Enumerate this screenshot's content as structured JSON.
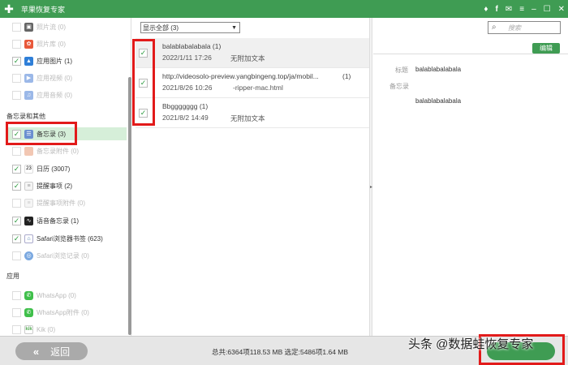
{
  "app": {
    "title": "苹果恢复专家",
    "logo_icon": "plus-logo-icon"
  },
  "sidebar": {
    "items_top": [
      {
        "label": "照片流 (0)",
        "checked": false,
        "dim": true,
        "icon": "photo-stream-icon",
        "color": "#666"
      },
      {
        "label": "照片库 (0)",
        "checked": false,
        "dim": true,
        "icon": "photo-library-icon",
        "color": "#e8583a"
      },
      {
        "label": "应用图片 (1)",
        "checked": true,
        "dim": false,
        "icon": "app-photos-icon",
        "color": "#2f7fd8"
      },
      {
        "label": "应用视频 (0)",
        "checked": false,
        "dim": true,
        "icon": "app-video-icon",
        "color": "#9bb8e8"
      },
      {
        "label": "应用音频 (0)",
        "checked": false,
        "dim": true,
        "icon": "app-audio-icon",
        "color": "#9bb8e8"
      }
    ],
    "section_memo": "备忘录和其他",
    "items_memo": [
      {
        "label": "备忘录 (3)",
        "checked": true,
        "dim": false,
        "icon": "notes-icon",
        "color": "#6a8fd0",
        "selected": true
      },
      {
        "label": "备忘录附件 (0)",
        "checked": false,
        "dim": true,
        "icon": "notes-attachment-icon",
        "color": "#ddd"
      },
      {
        "label": "日历 (3007)",
        "checked": true,
        "dim": false,
        "icon": "calendar-icon",
        "color": "#fff"
      },
      {
        "label": "提醒事项 (2)",
        "checked": true,
        "dim": false,
        "icon": "reminders-icon",
        "color": "#ddd"
      },
      {
        "label": "提醒事项附件 (0)",
        "checked": false,
        "dim": true,
        "icon": "reminders-attachment-icon",
        "color": "#ddd"
      },
      {
        "label": "语音备忘录 (1)",
        "checked": true,
        "dim": false,
        "icon": "voice-memo-icon",
        "color": "#222"
      },
      {
        "label": "Safari浏览器书签 (623)",
        "checked": true,
        "dim": false,
        "icon": "safari-bookmark-icon",
        "color": "#fff"
      },
      {
        "label": "Safari浏览记录 (0)",
        "checked": false,
        "dim": true,
        "icon": "safari-history-icon",
        "color": "#7aa8e0"
      }
    ],
    "section_apps": "应用",
    "items_apps": [
      {
        "label": "WhatsApp (0)",
        "checked": false,
        "dim": true,
        "icon": "whatsapp-icon",
        "color": "#3fbf4a"
      },
      {
        "label": "WhatsApp附件 (0)",
        "checked": false,
        "dim": true,
        "icon": "whatsapp-attachment-icon",
        "color": "#3fbf4a"
      },
      {
        "label": "Kik (0)",
        "checked": false,
        "dim": true,
        "icon": "kik-icon",
        "color": "#fff"
      }
    ]
  },
  "list": {
    "filter": "显示全部 (3)",
    "rows": [
      {
        "title": "balablabalabala (1)",
        "date": "2022/1/11 17:26",
        "sub": "无附加文本",
        "checked": true
      },
      {
        "title": "http://videosolo-preview.yangbingeng.top/ja/mobil...",
        "count": "(1)",
        "date": "2021/8/26 10:26",
        "sub": "-ripper-mac.html",
        "checked": true
      },
      {
        "title": "Bbggggggg (1)",
        "date": "2021/8/2 14:49",
        "sub": "无附加文本",
        "checked": true
      }
    ]
  },
  "search": {
    "placeholder": "搜索"
  },
  "detail": {
    "edit_label": "编辑",
    "title_label": "标题",
    "title_value": "balablabalabala",
    "memo_label": "备忘录",
    "memo_value": "balablabalabala"
  },
  "bottom": {
    "back_label": "返回",
    "totals": "总共:6364项118.53 MB 选定:5486项1.64 MB"
  },
  "watermark": "头条 @数据蛙恢复专家",
  "colors": {
    "accent": "#3f9c53",
    "highlight_box": "#e21a1a"
  }
}
